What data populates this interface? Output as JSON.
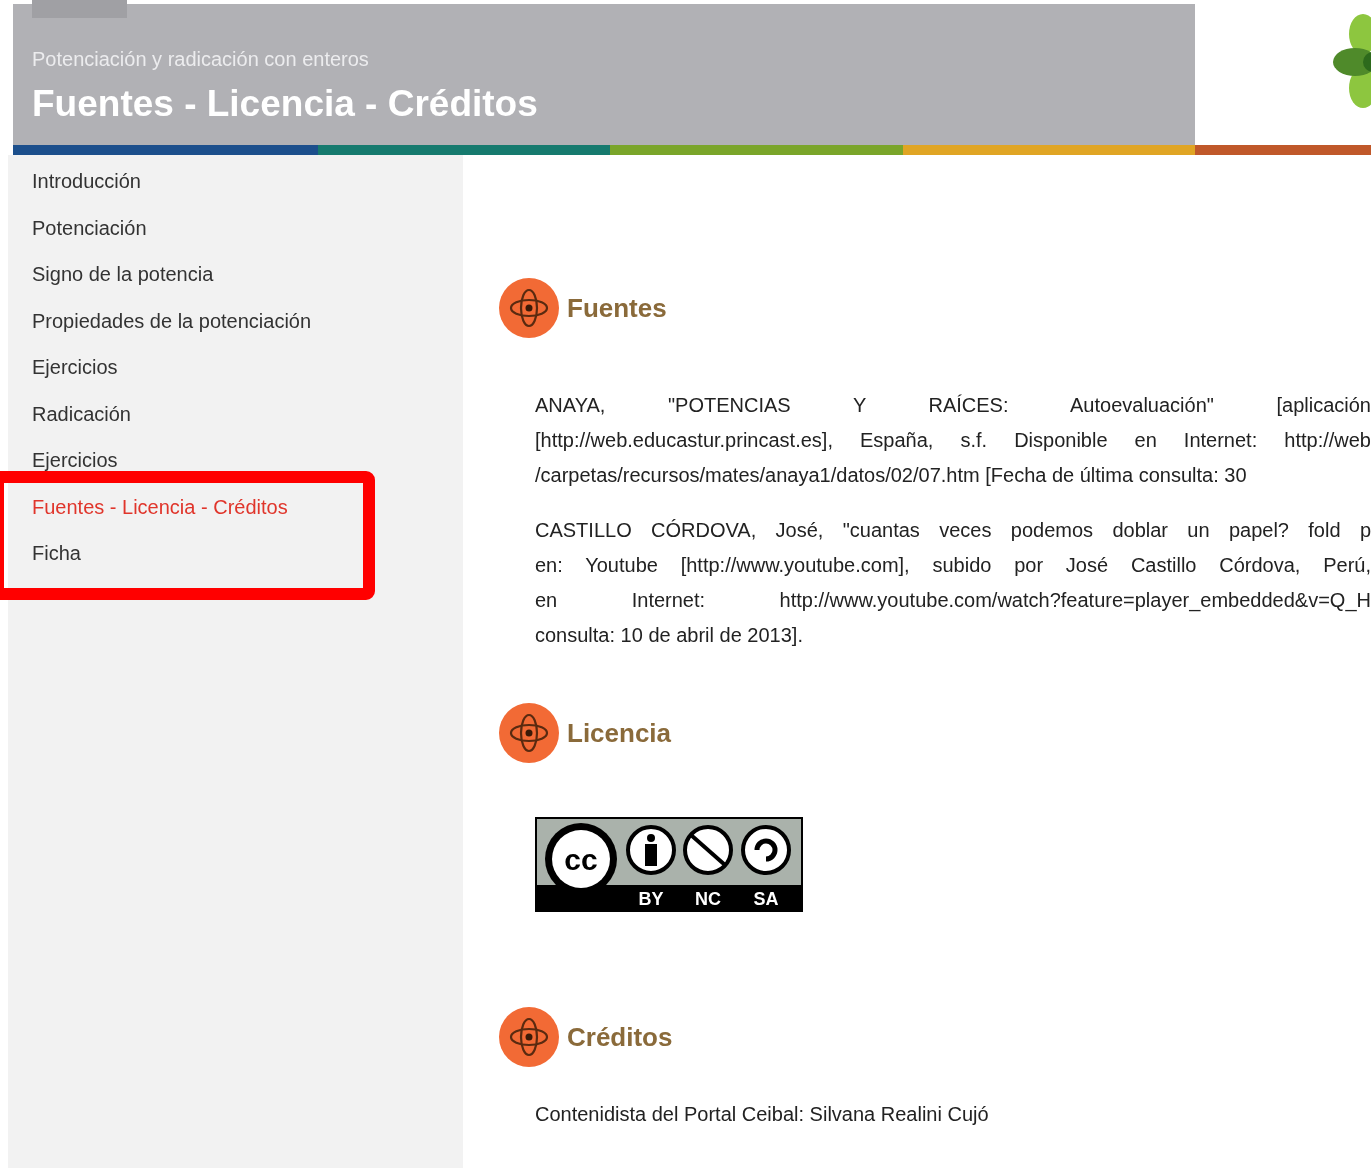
{
  "header": {
    "subtitle": "Potenciación y radicación con enteros",
    "title": "Fuentes - Licencia - Créditos"
  },
  "sidebar": {
    "items": [
      {
        "label": "Introducción",
        "selected": false
      },
      {
        "label": "Potenciación",
        "selected": false
      },
      {
        "label": "Signo de la potencia",
        "selected": false
      },
      {
        "label": "Propiedades de la potenciación",
        "selected": false
      },
      {
        "label": "Ejercicios",
        "selected": false
      },
      {
        "label": "Radicación",
        "selected": false
      },
      {
        "label": "Ejercicios",
        "selected": false
      },
      {
        "label": "Fuentes - Licencia - Créditos",
        "selected": true
      },
      {
        "label": "Ficha",
        "selected": false
      }
    ]
  },
  "sections": [
    {
      "kind": "text",
      "heading": "Fuentes",
      "paragraphs": [
        [
          "ANAYA, \"POTENCIAS Y RAÍCES: Autoevaluación\" [aplicación",
          "[http://web.educastur.princast.es], España, s.f. Disponible en Internet: http://web",
          "/carpetas/recursos/mates/anaya1/datos/02/07.htm [Fecha de última consulta: 30"
        ],
        [
          "CASTILLO CÓRDOVA, José, \"cuantas veces podemos doblar un papel? fold p",
          "en: Youtube [http://www.youtube.com], subido por José Castillo Córdova, Perú,",
          "en Internet: http://www.youtube.com/watch?feature=player_embedded&v=Q_H",
          "consulta: 10 de abril de 2013]."
        ]
      ]
    },
    {
      "kind": "license",
      "heading": "Licencia",
      "badge": {
        "logo": "cc",
        "labels": [
          "BY",
          "NC",
          "SA"
        ]
      }
    },
    {
      "kind": "text",
      "heading": "Créditos",
      "paragraphs": [
        [
          "Contenidista del Portal Ceibal: Silvana Realini Cujó"
        ]
      ]
    }
  ]
}
